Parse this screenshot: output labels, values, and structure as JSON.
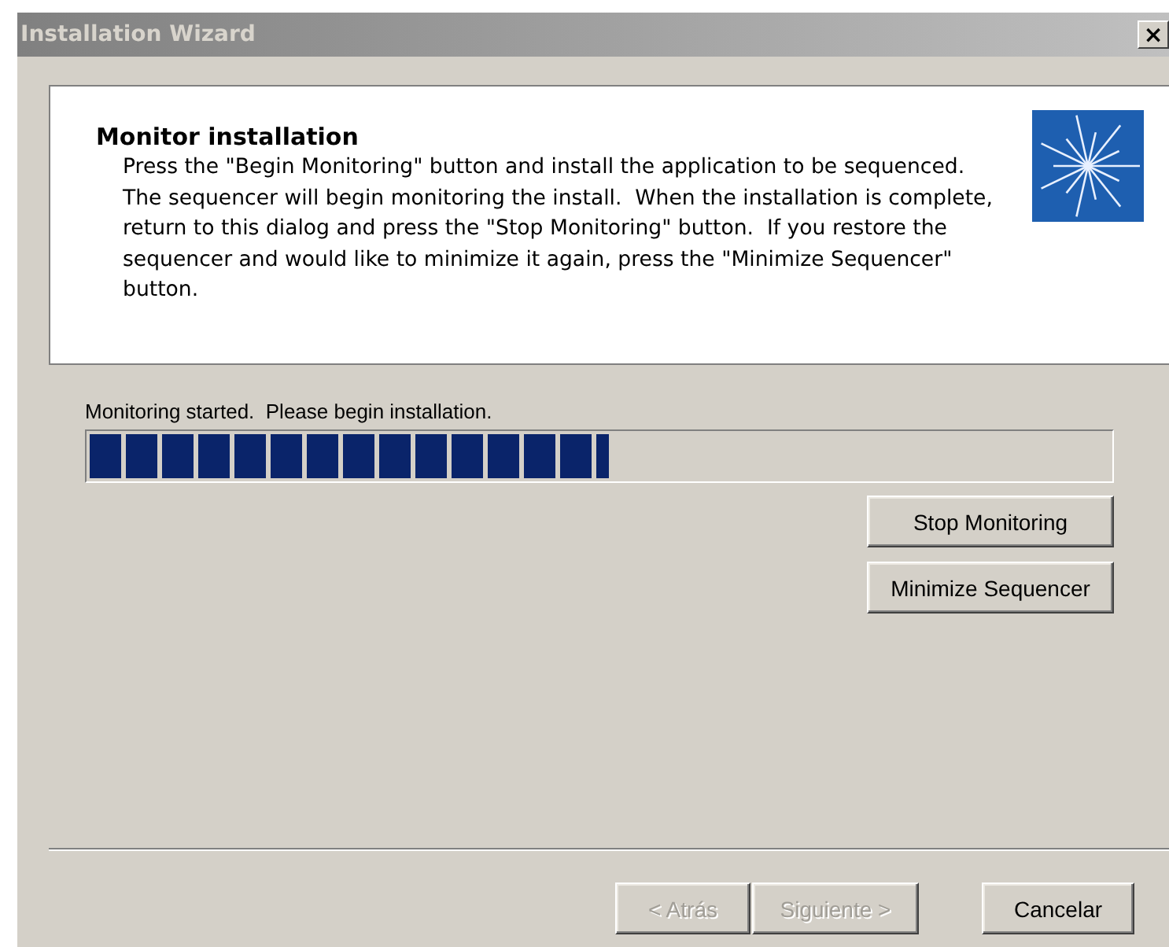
{
  "window": {
    "title": "Installation Wizard",
    "close": "×"
  },
  "header": {
    "title": "Monitor installation",
    "body": "Press the \"Begin Monitoring\" button and install the application to be sequenced.  The sequencer will begin monitoring the install.  When the installation is complete, return to this dialog and press the \"Stop Monitoring\" button.  If you restore the sequencer and would like to minimize it again, press the \"Minimize Sequencer\" button."
  },
  "status": "Monitoring started.  Please begin installation.",
  "progress": {
    "level": 0.51
  },
  "actions": [
    {
      "label": "Stop Monitoring",
      "disabled": false
    },
    {
      "label": "Minimize Sequencer",
      "disabled": false
    }
  ],
  "footer_buttons": [
    {
      "label": "< Atrás",
      "disabled": true
    },
    {
      "label": "Siguiente >",
      "disabled": true
    },
    {
      "label": "Cancelar",
      "disabled": false
    }
  ]
}
